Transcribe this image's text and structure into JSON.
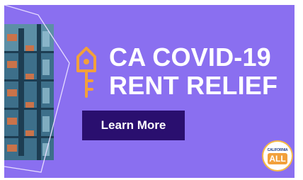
{
  "ad": {
    "headline_line1": "CA COVID-19",
    "headline_line2": "RENT RELIEF",
    "cta_label": "Learn More",
    "logo_top_text": "CALIFORNIA",
    "logo_badge_text": "ALL",
    "icons": {
      "house_key": "house-key-icon",
      "building_photo": "building-photo"
    },
    "colors": {
      "background": "#8a6ff0",
      "cta_background": "#2a0f6f",
      "accent_orange": "#f2a03b",
      "text": "#ffffff"
    }
  }
}
